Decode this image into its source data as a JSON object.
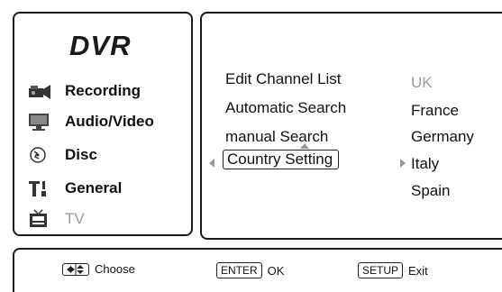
{
  "sidebar": {
    "logo": "DVR",
    "items": [
      {
        "label": "Recording",
        "icon": "camcorder-icon"
      },
      {
        "label": "Audio/Video",
        "icon": "monitor-icon"
      },
      {
        "label": "Disc",
        "icon": "disc-icon"
      },
      {
        "label": "General",
        "icon": "tools-icon"
      },
      {
        "label": "TV",
        "icon": "tv-icon"
      }
    ]
  },
  "menu": {
    "items": [
      {
        "label": "Edit Channel List"
      },
      {
        "label": "Automatic Search"
      },
      {
        "label": "manual Search"
      },
      {
        "label": "Country Setting"
      }
    ],
    "selected": "Country Setting",
    "options": [
      "UK",
      "France",
      "Germany",
      "Italy",
      "Spain"
    ],
    "current_option": "UK"
  },
  "footer": {
    "choose_label": "Choose",
    "enter_key": "ENTER",
    "ok_label": "OK",
    "setup_key": "SETUP",
    "exit_label": "Exit"
  }
}
